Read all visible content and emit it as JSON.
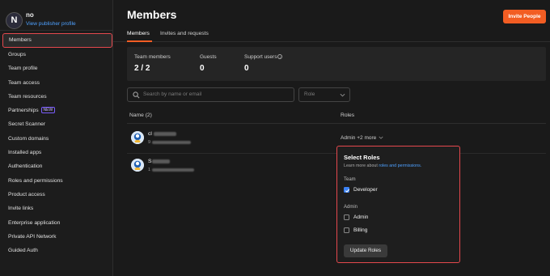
{
  "profile": {
    "initial": "N",
    "name": "no",
    "link": "View publisher profile"
  },
  "sidebar": {
    "items": [
      {
        "label": "Members",
        "active": true
      },
      {
        "label": "Groups"
      },
      {
        "label": "Team profile"
      },
      {
        "label": "Team access"
      },
      {
        "label": "Team resources"
      },
      {
        "label": "Partnerships",
        "badge": "NEW"
      },
      {
        "label": "Secret Scanner"
      },
      {
        "label": "Custom domains"
      },
      {
        "label": "Installed apps"
      },
      {
        "label": "Authentication"
      },
      {
        "label": "Roles and permissions"
      },
      {
        "label": "Product access"
      },
      {
        "label": "Invite links"
      },
      {
        "label": "Enterprise application"
      },
      {
        "label": "Private API Network"
      },
      {
        "label": "Guided Auth"
      }
    ]
  },
  "header": {
    "title": "Members",
    "invite_label": "Invite People"
  },
  "tabs": [
    {
      "label": "Members"
    },
    {
      "label": "Invites and requests"
    }
  ],
  "stats": [
    {
      "label": "Team members",
      "value": "2 / 2"
    },
    {
      "label": "Guests",
      "value": "0"
    },
    {
      "label": "Support users",
      "value": "0"
    }
  ],
  "filters": {
    "search_placeholder": "Search by name or email",
    "role_placeholder": "Role"
  },
  "table": {
    "name_header": "Name (2)",
    "roles_header": "Roles",
    "rows": [
      {
        "name_prefix": "cl",
        "sub_prefix": "9",
        "roles": "Admin +2 more"
      },
      {
        "name_prefix": "S",
        "sub_prefix": "1"
      }
    ]
  },
  "popup": {
    "title": "Select Roles",
    "desc": "Learn more about",
    "desc_link": "roles and permissions.",
    "team_label": "Team",
    "admin_label": "Admin",
    "options": [
      {
        "label": "Developer",
        "checked": true
      },
      {
        "label": "Admin",
        "checked": false
      },
      {
        "label": "Billing",
        "checked": false
      }
    ],
    "update_label": "Update Roles"
  },
  "colors": {
    "accent": "#f25d23",
    "highlight": "#e5484d",
    "link": "#4ea1ff",
    "checkbox": "#3b82f6"
  }
}
